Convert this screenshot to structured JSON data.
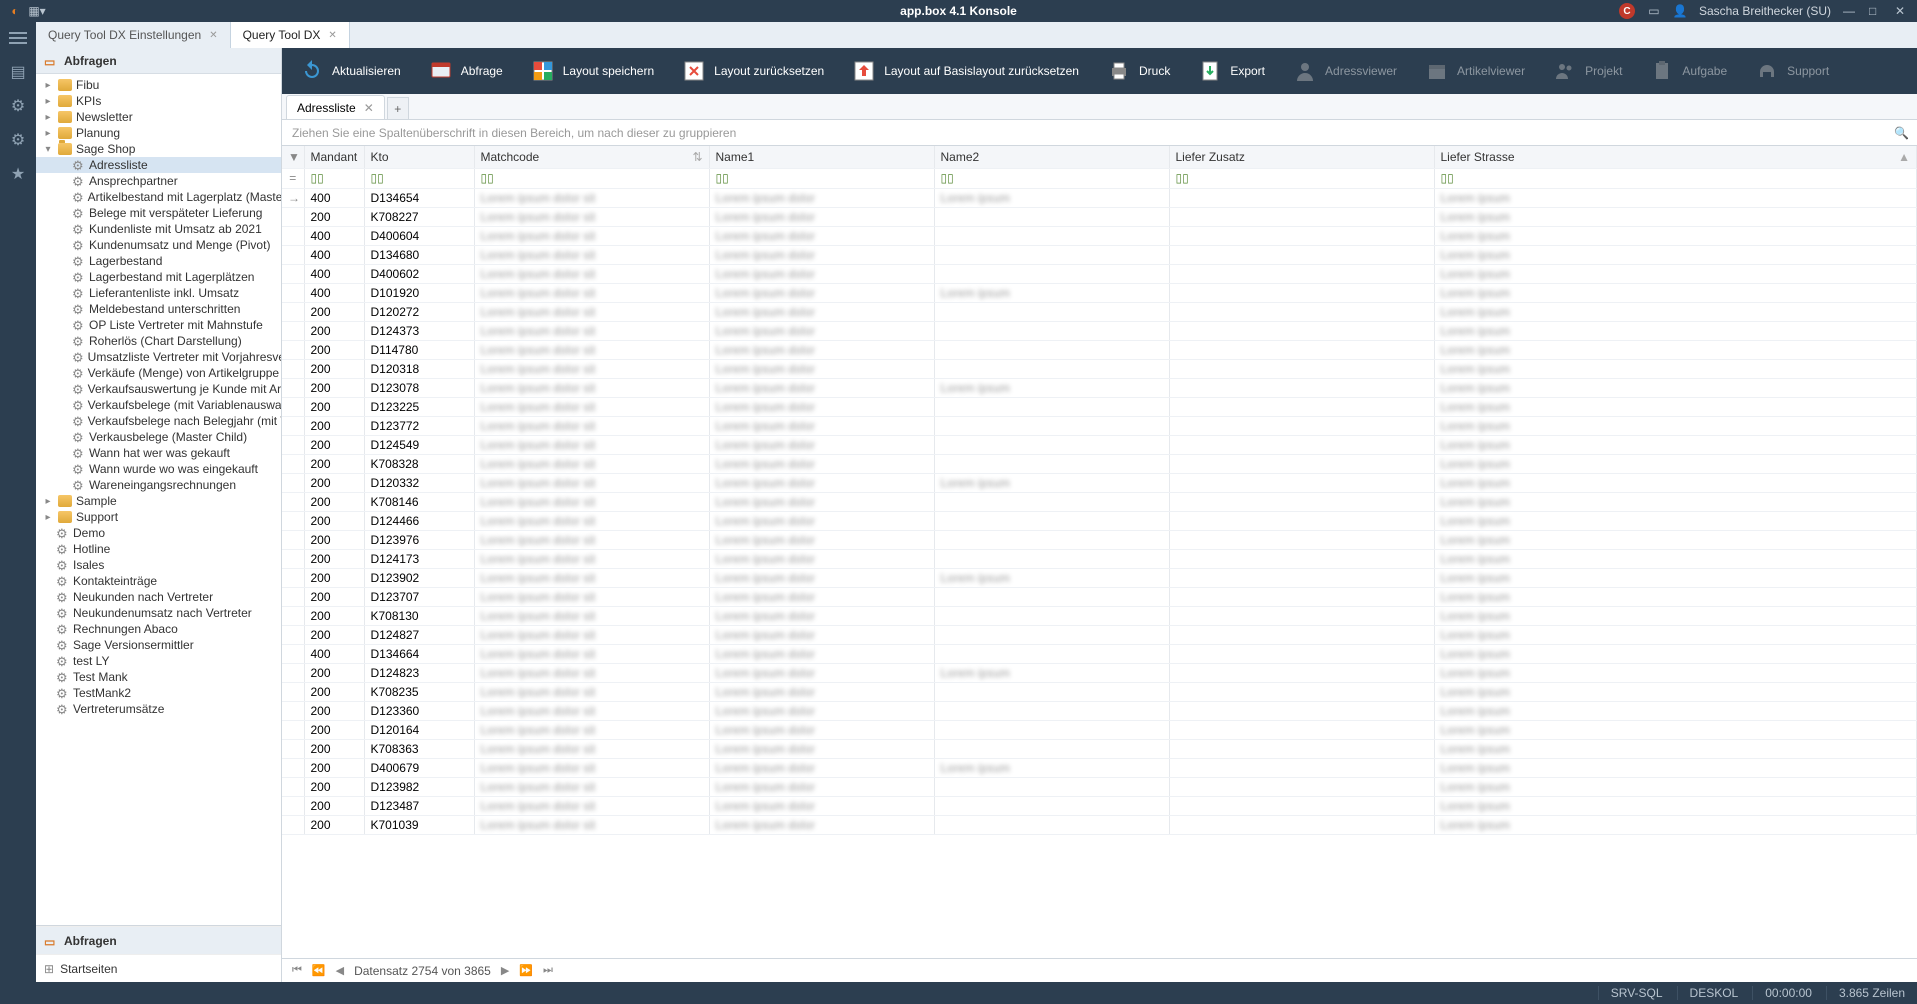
{
  "app_title": "app.box 4.1 Konsole",
  "user": "Sascha Breithecker (SU)",
  "tabs": [
    {
      "label": "Query Tool DX Einstellungen",
      "active": false
    },
    {
      "label": "Query Tool DX",
      "active": true
    }
  ],
  "side_header": "Abfragen",
  "tree": {
    "folders": [
      {
        "label": "Fibu",
        "open": false,
        "children": []
      },
      {
        "label": "KPIs",
        "open": false,
        "children": []
      },
      {
        "label": "Newsletter",
        "open": false,
        "children": []
      },
      {
        "label": "Planung",
        "open": false,
        "children": []
      },
      {
        "label": "Sage Shop",
        "open": true,
        "children": [
          "Adressliste",
          "Ansprechpartner",
          "Artikelbestand mit Lagerplatz (Master Child)",
          "Belege mit verspäteter Lieferung",
          "Kundenliste mit Umsatz ab 2021",
          "Kundenumsatz und Menge (Pivot)",
          "Lagerbestand",
          "Lagerbestand mit Lagerplätzen",
          "Lieferantenliste inkl. Umsatz",
          "Meldebestand unterschritten",
          "OP Liste Vertreter mit Mahnstufe",
          "Roherlös (Chart Darstellung)",
          "Umsatzliste Vertreter mit Vorjahresvergleich",
          "Verkäufe (Menge) von Artikelgruppe pro Kalend…",
          "Verkaufsauswertung je Kunde mit Artikeln",
          "Verkaufsbelege (mit Variablenauswahl)",
          "Verkaufsbelege nach Belegjahr (mit Variablenaus…",
          "Verkausbelege (Master Child)",
          "Wann hat wer was gekauft",
          "Wann wurde wo was eingekauft",
          "Wareneingangsrechnungen"
        ]
      },
      {
        "label": "Sample",
        "open": false,
        "children": []
      },
      {
        "label": "Support",
        "open": false,
        "children": []
      }
    ],
    "root_items": [
      "Demo",
      "Hotline",
      "Isales",
      "Kontakteinträge",
      "Neukunden nach Vertreter",
      "Neukundenumsatz nach Vertreter",
      "Rechnungen Abaco",
      "Sage Versionsermittler",
      "test LY",
      "Test Mank",
      "TestMank2",
      "Vertreterumsätze"
    ]
  },
  "side_bottom": [
    "Abfragen",
    "Startseiten"
  ],
  "toolbar": [
    {
      "label": "Aktualisieren",
      "icon": "refresh"
    },
    {
      "label": "Abfrage",
      "icon": "query"
    },
    {
      "label": "Layout speichern",
      "icon": "layout-save"
    },
    {
      "label": "Layout zurücksetzen",
      "icon": "layout-reset"
    },
    {
      "label": "Layout auf Basislayout zurücksetzen",
      "icon": "layout-base"
    },
    {
      "label": "Druck",
      "icon": "print"
    },
    {
      "label": "Export",
      "icon": "export"
    },
    {
      "label": "Adressviewer",
      "icon": "user",
      "disabled": true
    },
    {
      "label": "Artikelviewer",
      "icon": "box",
      "disabled": true
    },
    {
      "label": "Projekt",
      "icon": "people",
      "disabled": true
    },
    {
      "label": "Aufgabe",
      "icon": "clipboard",
      "disabled": true
    },
    {
      "label": "Support",
      "icon": "headset",
      "disabled": true
    }
  ],
  "subtab": "Adressliste",
  "groupbar_hint": "Ziehen Sie eine Spaltenüberschrift in diesen Bereich, um nach dieser zu gruppieren",
  "columns": [
    "Mandant",
    "Kto",
    "Matchcode",
    "Name1",
    "Name2",
    "Liefer Zusatz",
    "Liefer Strasse"
  ],
  "filter_eq": "=",
  "rows": [
    {
      "mandant": 400,
      "kto": "D134654"
    },
    {
      "mandant": 200,
      "kto": "K708227"
    },
    {
      "mandant": 400,
      "kto": "D400604"
    },
    {
      "mandant": 400,
      "kto": "D134680"
    },
    {
      "mandant": 400,
      "kto": "D400602"
    },
    {
      "mandant": 400,
      "kto": "D101920"
    },
    {
      "mandant": 200,
      "kto": "D120272"
    },
    {
      "mandant": 200,
      "kto": "D124373"
    },
    {
      "mandant": 200,
      "kto": "D114780"
    },
    {
      "mandant": 200,
      "kto": "D120318"
    },
    {
      "mandant": 200,
      "kto": "D123078"
    },
    {
      "mandant": 200,
      "kto": "D123225"
    },
    {
      "mandant": 200,
      "kto": "D123772"
    },
    {
      "mandant": 200,
      "kto": "D124549"
    },
    {
      "mandant": 200,
      "kto": "K708328"
    },
    {
      "mandant": 200,
      "kto": "D120332"
    },
    {
      "mandant": 200,
      "kto": "K708146"
    },
    {
      "mandant": 200,
      "kto": "D124466"
    },
    {
      "mandant": 200,
      "kto": "D123976"
    },
    {
      "mandant": 200,
      "kto": "D124173"
    },
    {
      "mandant": 200,
      "kto": "D123902"
    },
    {
      "mandant": 200,
      "kto": "D123707"
    },
    {
      "mandant": 200,
      "kto": "K708130"
    },
    {
      "mandant": 200,
      "kto": "D124827"
    },
    {
      "mandant": 400,
      "kto": "D134664"
    },
    {
      "mandant": 200,
      "kto": "D124823"
    },
    {
      "mandant": 200,
      "kto": "K708235"
    },
    {
      "mandant": 200,
      "kto": "D123360"
    },
    {
      "mandant": 200,
      "kto": "D120164"
    },
    {
      "mandant": 200,
      "kto": "K708363"
    },
    {
      "mandant": 200,
      "kto": "D400679"
    },
    {
      "mandant": 200,
      "kto": "D123982"
    },
    {
      "mandant": 200,
      "kto": "D123487"
    },
    {
      "mandant": 200,
      "kto": "K701039"
    }
  ],
  "pager": "Datensatz 2754 von 3865",
  "status": {
    "server": "SRV-SQL",
    "machine": "DESKOL",
    "time": "00:00:00",
    "rows": "3.865 Zeilen"
  }
}
